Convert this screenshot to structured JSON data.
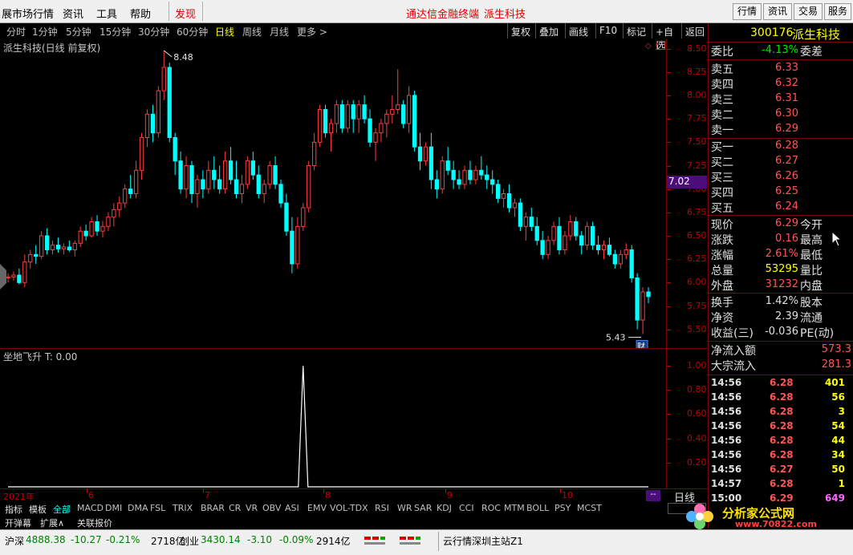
{
  "menu": {
    "items": [
      "展市场行情",
      "资讯",
      "工具",
      "帮助"
    ],
    "discover": "发现",
    "center_title": "通达信金融终端",
    "center_stock": "派生科技",
    "right_buttons": [
      "行情",
      "资讯",
      "交易",
      "服务"
    ]
  },
  "timeframes": [
    "分时",
    "1分钟",
    "5分钟",
    "15分钟",
    "30分钟",
    "60分钟",
    "日线",
    "周线",
    "月线",
    "更多 >"
  ],
  "active_timeframe": "日线",
  "tools": [
    "复权",
    "叠加",
    "画线",
    "F10",
    "标记",
    "+自选",
    "返回"
  ],
  "chart": {
    "title": "派生科技(日线 前复权)",
    "high_label": "8.48",
    "low_label": "5.43",
    "badge": "财",
    "price_marker": "7.02",
    "y_ticks": [
      "8.50",
      "8.25",
      "8.00",
      "7.75",
      "7.50",
      "7.25",
      "7.00",
      "6.75",
      "6.50",
      "6.25",
      "6.00",
      "5.75",
      "5.50"
    ],
    "ind_title": "坐地飞升 T: 0.00",
    "ind_ticks": [
      "1.00",
      "0.80",
      "0.60",
      "0.40",
      "0.20"
    ],
    "x_labels": [
      "2021年",
      "6",
      "7",
      "8",
      "9",
      "10"
    ],
    "period_label": "日线",
    "scroll_label": "--"
  },
  "chart_data": {
    "type": "candlestick",
    "title": "派生科技(日线 前复权)",
    "ylim": [
      5.3,
      8.6
    ],
    "candles": [
      [
        6.05,
        6.1,
        6.0,
        6.06
      ],
      [
        6.06,
        6.12,
        6.02,
        6.08
      ],
      [
        6.08,
        6.15,
        5.98,
        6.0
      ],
      [
        6.0,
        6.3,
        5.95,
        6.22
      ],
      [
        6.22,
        6.35,
        6.15,
        6.3
      ],
      [
        6.3,
        6.4,
        6.2,
        6.28
      ],
      [
        6.28,
        6.55,
        6.25,
        6.5
      ],
      [
        6.5,
        6.58,
        6.3,
        6.35
      ],
      [
        6.35,
        6.45,
        6.3,
        6.4
      ],
      [
        6.4,
        6.48,
        6.32,
        6.36
      ],
      [
        6.36,
        6.42,
        6.3,
        6.38
      ],
      [
        6.38,
        6.45,
        6.33,
        6.35
      ],
      [
        6.35,
        6.45,
        6.28,
        6.42
      ],
      [
        6.42,
        6.6,
        6.38,
        6.55
      ],
      [
        6.55,
        6.62,
        6.45,
        6.5
      ],
      [
        6.5,
        6.7,
        6.48,
        6.65
      ],
      [
        6.65,
        6.72,
        6.5,
        6.55
      ],
      [
        6.55,
        6.66,
        6.48,
        6.6
      ],
      [
        6.6,
        6.75,
        6.55,
        6.7
      ],
      [
        6.7,
        6.85,
        6.6,
        6.78
      ],
      [
        6.78,
        6.92,
        6.7,
        6.85
      ],
      [
        6.85,
        7.05,
        6.8,
        7.0
      ],
      [
        7.0,
        7.15,
        6.9,
        6.95
      ],
      [
        6.95,
        7.3,
        6.9,
        7.2
      ],
      [
        7.2,
        7.6,
        7.1,
        7.55
      ],
      [
        7.55,
        7.85,
        7.45,
        7.8
      ],
      [
        7.8,
        7.9,
        7.5,
        7.6
      ],
      [
        7.6,
        8.1,
        7.55,
        8.05
      ],
      [
        8.05,
        8.48,
        7.95,
        8.3
      ],
      [
        8.3,
        8.35,
        7.5,
        7.55
      ],
      [
        7.55,
        7.6,
        7.15,
        7.3
      ],
      [
        7.3,
        7.4,
        6.95,
        7.0
      ],
      [
        7.0,
        7.35,
        6.9,
        7.25
      ],
      [
        7.25,
        7.3,
        6.85,
        6.95
      ],
      [
        6.95,
        7.15,
        6.8,
        7.1
      ],
      [
        7.1,
        7.2,
        6.9,
        7.0
      ],
      [
        7.0,
        7.3,
        6.95,
        7.2
      ],
      [
        7.2,
        7.35,
        7.0,
        7.1
      ],
      [
        7.1,
        7.25,
        6.95,
        7.0
      ],
      [
        7.0,
        7.4,
        6.95,
        7.3
      ],
      [
        7.3,
        7.45,
        7.05,
        7.1
      ],
      [
        7.1,
        7.3,
        6.9,
        6.95
      ],
      [
        6.95,
        7.15,
        6.85,
        7.05
      ],
      [
        7.05,
        7.35,
        7.0,
        7.3
      ],
      [
        7.3,
        7.4,
        7.1,
        7.15
      ],
      [
        7.15,
        7.25,
        6.9,
        6.95
      ],
      [
        6.95,
        7.1,
        6.85,
        7.05
      ],
      [
        7.05,
        7.3,
        7.0,
        7.25
      ],
      [
        7.25,
        7.35,
        7.0,
        7.05
      ],
      [
        7.05,
        7.1,
        6.8,
        6.85
      ],
      [
        6.85,
        6.95,
        6.5,
        6.55
      ],
      [
        6.55,
        6.7,
        6.1,
        6.2
      ],
      [
        6.2,
        6.7,
        6.15,
        6.6
      ],
      [
        6.6,
        6.85,
        6.55,
        6.8
      ],
      [
        6.8,
        7.3,
        6.75,
        7.25
      ],
      [
        7.25,
        7.6,
        7.2,
        7.5
      ],
      [
        7.5,
        7.9,
        7.45,
        7.85
      ],
      [
        7.85,
        7.9,
        7.55,
        7.6
      ],
      [
        7.6,
        7.75,
        7.4,
        7.7
      ],
      [
        7.7,
        7.95,
        7.6,
        7.9
      ],
      [
        7.9,
        7.95,
        7.6,
        7.65
      ],
      [
        7.65,
        7.95,
        7.6,
        7.9
      ],
      [
        7.9,
        7.95,
        7.6,
        7.75
      ],
      [
        7.75,
        7.95,
        7.6,
        7.9
      ],
      [
        7.9,
        8.0,
        7.7,
        7.75
      ],
      [
        7.75,
        7.85,
        7.45,
        7.5
      ],
      [
        7.5,
        7.65,
        7.3,
        7.6
      ],
      [
        7.6,
        7.75,
        7.5,
        7.7
      ],
      [
        7.7,
        7.85,
        7.55,
        7.8
      ],
      [
        7.8,
        8.0,
        7.7,
        7.85
      ],
      [
        7.85,
        8.28,
        7.8,
        7.9
      ],
      [
        7.9,
        7.95,
        7.65,
        7.7
      ],
      [
        7.7,
        8.1,
        7.6,
        8.0
      ],
      [
        8.0,
        8.05,
        7.4,
        7.45
      ],
      [
        7.45,
        7.6,
        7.2,
        7.3
      ],
      [
        7.3,
        7.5,
        7.25,
        7.45
      ],
      [
        7.45,
        7.6,
        7.0,
        7.1
      ],
      [
        7.1,
        7.2,
        6.9,
        7.0
      ],
      [
        7.0,
        7.35,
        6.95,
        7.3
      ],
      [
        7.3,
        7.45,
        7.15,
        7.2
      ],
      [
        7.2,
        7.3,
        7.0,
        7.1
      ],
      [
        7.1,
        7.2,
        7.0,
        7.05
      ],
      [
        7.05,
        7.25,
        7.0,
        7.2
      ],
      [
        7.2,
        7.3,
        7.05,
        7.1
      ],
      [
        7.1,
        7.25,
        7.05,
        7.2
      ],
      [
        7.2,
        7.35,
        7.1,
        7.15
      ],
      [
        7.15,
        7.25,
        7.0,
        7.1
      ],
      [
        7.1,
        7.2,
        6.95,
        7.05
      ],
      [
        7.05,
        7.1,
        6.85,
        6.9
      ],
      [
        6.9,
        7.0,
        6.8,
        6.95
      ],
      [
        6.95,
        7.05,
        6.75,
        6.8
      ],
      [
        6.8,
        6.9,
        6.7,
        6.85
      ],
      [
        6.85,
        6.9,
        6.55,
        6.6
      ],
      [
        6.6,
        6.75,
        6.45,
        6.7
      ],
      [
        6.7,
        6.8,
        6.55,
        6.6
      ],
      [
        6.6,
        6.7,
        6.4,
        6.45
      ],
      [
        6.45,
        6.55,
        6.25,
        6.3
      ],
      [
        6.3,
        6.5,
        6.25,
        6.45
      ],
      [
        6.45,
        6.65,
        6.4,
        6.6
      ],
      [
        6.6,
        6.7,
        6.3,
        6.35
      ],
      [
        6.35,
        6.55,
        6.3,
        6.5
      ],
      [
        6.5,
        6.72,
        6.45,
        6.65
      ],
      [
        6.65,
        6.7,
        6.45,
        6.5
      ],
      [
        6.5,
        6.55,
        6.3,
        6.4
      ],
      [
        6.4,
        6.65,
        6.35,
        6.6
      ],
      [
        6.6,
        6.65,
        6.35,
        6.4
      ],
      [
        6.4,
        6.5,
        6.3,
        6.35
      ],
      [
        6.35,
        6.45,
        6.25,
        6.4
      ],
      [
        6.4,
        6.48,
        6.28,
        6.3
      ],
      [
        6.3,
        6.35,
        6.15,
        6.2
      ],
      [
        6.2,
        6.35,
        6.15,
        6.3
      ],
      [
        6.3,
        6.42,
        6.25,
        6.35
      ],
      [
        6.35,
        6.4,
        6.0,
        6.05
      ],
      [
        6.05,
        6.1,
        5.5,
        5.6
      ],
      [
        5.6,
        5.95,
        5.45,
        5.9
      ],
      [
        5.9,
        5.95,
        5.78,
        5.85
      ]
    ],
    "indicator": {
      "name": "坐地飞升",
      "ylim": [
        0,
        1.1
      ],
      "spike_index": 53,
      "spike_value": 1.0
    }
  },
  "panel": {
    "code": "300176",
    "name": "派生科技",
    "weibi_label": "委比",
    "weibi_value": "-4.13%",
    "weicha_label": "委差",
    "asks": [
      {
        "label": "卖五",
        "price": "6.33"
      },
      {
        "label": "卖四",
        "price": "6.32"
      },
      {
        "label": "卖三",
        "price": "6.31"
      },
      {
        "label": "卖二",
        "price": "6.30"
      },
      {
        "label": "卖一",
        "price": "6.29"
      }
    ],
    "bids": [
      {
        "label": "买一",
        "price": "6.28"
      },
      {
        "label": "买二",
        "price": "6.27"
      },
      {
        "label": "买三",
        "price": "6.26"
      },
      {
        "label": "买四",
        "price": "6.25"
      },
      {
        "label": "买五",
        "price": "6.24"
      }
    ],
    "stats": [
      {
        "label": "现价",
        "value": "6.29",
        "label2": "今开"
      },
      {
        "label": "涨跌",
        "value": "0.16",
        "label2": "最高"
      },
      {
        "label": "涨幅",
        "value": "2.61%",
        "label2": "最低"
      },
      {
        "label": "总量",
        "value": "53295",
        "label2": "量比"
      },
      {
        "label": "外盘",
        "value": "31232",
        "label2": "内盘"
      }
    ],
    "stats2": [
      {
        "label": "换手",
        "value": "1.42%",
        "label2": "股本"
      },
      {
        "label": "净资",
        "value": "2.39",
        "label2": "流通"
      },
      {
        "label": "收益(三)",
        "value": "-0.036",
        "label2": "PE(动)"
      }
    ],
    "flows": [
      {
        "label": "净流入额",
        "value": "573.3"
      },
      {
        "label": "大宗流入",
        "value": "281.3"
      }
    ],
    "ticks": [
      {
        "time": "14:56",
        "price": "6.28",
        "vol": "401"
      },
      {
        "time": "14:56",
        "price": "6.28",
        "vol": "56"
      },
      {
        "time": "14:56",
        "price": "6.28",
        "vol": "3"
      },
      {
        "time": "14:56",
        "price": "6.28",
        "vol": "54"
      },
      {
        "time": "14:56",
        "price": "6.28",
        "vol": "44"
      },
      {
        "time": "14:56",
        "price": "6.28",
        "vol": "34"
      },
      {
        "time": "14:56",
        "price": "6.27",
        "vol": "50"
      },
      {
        "time": "14:57",
        "price": "6.28",
        "vol": "1"
      },
      {
        "time": "15:00",
        "price": "6.29",
        "vol": "649"
      }
    ]
  },
  "indicator_tabs": [
    "指标",
    "模板",
    "全部",
    "MACD",
    "DMI",
    "DMA",
    "FSL",
    "TRIX",
    "BRAR",
    "CR",
    "VR",
    "OBV",
    "ASI",
    "EMV",
    "VOL-TDX",
    "RSI",
    "WR",
    "SAR",
    "KDJ",
    "CCI",
    "ROC",
    "MTM",
    "BOLL",
    "PSY",
    "MCST"
  ],
  "sub_tabs": [
    "开弹幕",
    "扩展∧",
    "关联报价"
  ],
  "status": {
    "sh_label": "沪深",
    "sh_value": "4888.38",
    "sh_change": "-10.27",
    "sh_pct": "-0.21%",
    "sh_amount": "2718亿",
    "cy_label": "创业",
    "cy_value": "3430.14",
    "cy_change": "-3.10",
    "cy_pct": "-0.09%",
    "cy_amount": "2914亿",
    "server": "云行情深圳主站Z1"
  },
  "watermark": {
    "name": "分析家公式网",
    "url": "www.70822.com"
  },
  "colors": {
    "up": "#ff3c3c",
    "down": "#00ffff",
    "grid": "#7a0000",
    "accent": "#ffff00"
  }
}
